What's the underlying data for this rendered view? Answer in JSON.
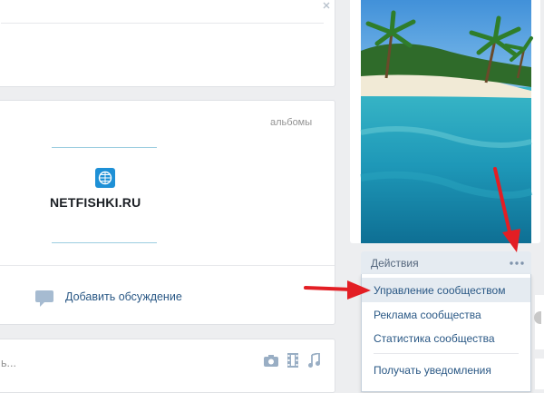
{
  "albums_block": {
    "header": "альбомы",
    "watermark_text": "NETFISHKI.RU"
  },
  "discussion": {
    "add_label": "Добавить обсуждение"
  },
  "post_box": {
    "placeholder_fragment": "ь..."
  },
  "actions": {
    "button_label": "Действия",
    "more_icon": "ellipsis-icon",
    "menu": [
      {
        "label": "Управление сообществом",
        "highlighted": true
      },
      {
        "label": "Реклама сообщества",
        "highlighted": false
      },
      {
        "label": "Статистика сообщества",
        "highlighted": false
      },
      {
        "label": "Получать уведомления",
        "highlighted": false
      }
    ]
  },
  "colors": {
    "accent": "#2a5885",
    "annotation_arrow": "#e31e24",
    "page_bg": "#edeef0",
    "menu_highlight": "#e5ebf1"
  }
}
